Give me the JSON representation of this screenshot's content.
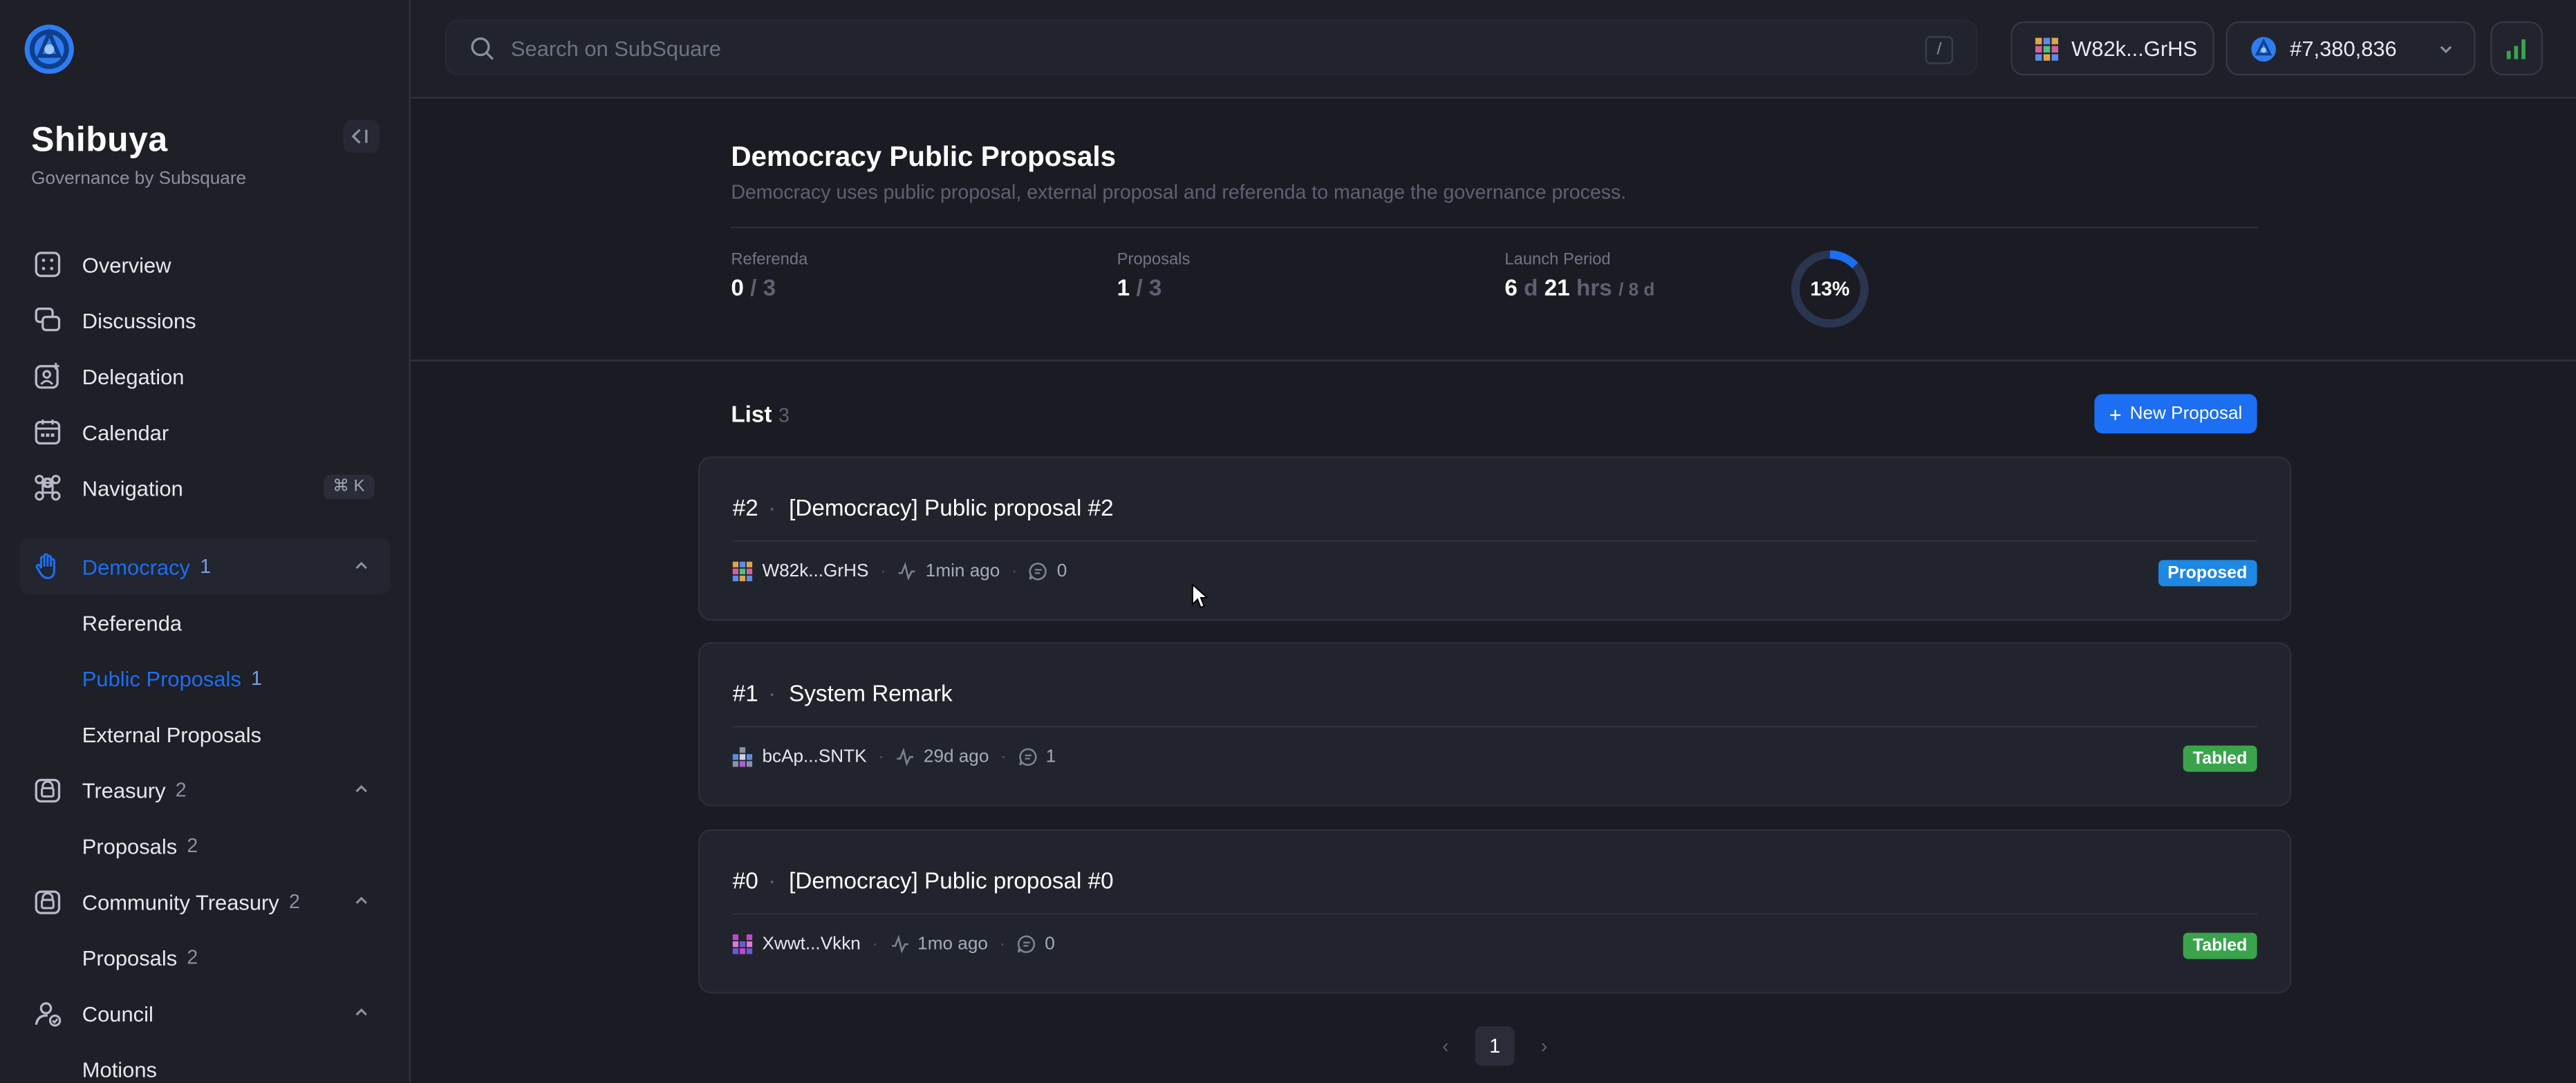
{
  "sidebar": {
    "title": "Shibuya",
    "subtitle": "Governance by Subsquare",
    "collapse_label": "<|",
    "items": [
      {
        "label": "Overview"
      },
      {
        "label": "Discussions"
      },
      {
        "label": "Delegation"
      },
      {
        "label": "Calendar"
      },
      {
        "label": "Navigation",
        "shortcut": "⌘ K"
      },
      {
        "label": "Democracy",
        "count": "1"
      },
      {
        "label": "Referenda"
      },
      {
        "label": "Public Proposals",
        "count": "1"
      },
      {
        "label": "External Proposals"
      },
      {
        "label": "Treasury",
        "count": "2"
      },
      {
        "label": "Proposals",
        "count": "2"
      },
      {
        "label": "Community Treasury",
        "count": "2"
      },
      {
        "label": "Proposals",
        "count": "2"
      },
      {
        "label": "Council"
      },
      {
        "label": "Motions"
      }
    ]
  },
  "topbar": {
    "search_placeholder": "Search on SubSquare",
    "search_shortcut": "/",
    "account": "W82k...GrHS",
    "block_number": "#7,380,836"
  },
  "summary": {
    "title": "Democracy Public Proposals",
    "description": "Democracy uses public proposal, external proposal and referenda to manage the governance process.",
    "referenda": {
      "label": "Referenda",
      "current": "0",
      "total": "/ 3"
    },
    "proposals": {
      "label": "Proposals",
      "current": "1",
      "total": "/ 3"
    },
    "launch": {
      "label": "Launch Period",
      "days": "6",
      "d_unit": "d",
      "hours": "21",
      "hrs_unit": "hrs",
      "total": "/ 8 d"
    },
    "progress_percent": 13,
    "progress_label": "13%"
  },
  "list": {
    "title": "List",
    "count": "3",
    "new_button": "New Proposal",
    "proposals": [
      {
        "index": "#2",
        "title": "[Democracy] Public proposal #2",
        "author": "W82k...GrHS",
        "time": "1min ago",
        "comments": "0",
        "status": "Proposed"
      },
      {
        "index": "#1",
        "title": "System Remark",
        "author": "bcAp...SNTK",
        "time": "29d ago",
        "comments": "1",
        "status": "Tabled"
      },
      {
        "index": "#0",
        "title": "[Democracy] Public proposal #0",
        "author": "Xwwt...Vkkn",
        "time": "1mo ago",
        "comments": "0",
        "status": "Tabled"
      }
    ]
  },
  "pagination": {
    "current": "1",
    "prev": "‹",
    "next": "›"
  },
  "colors": {
    "accent": "#1c6ef2",
    "proposed": "#1f87e4",
    "tabled": "#3aa44d",
    "background": "#1b1c23"
  }
}
